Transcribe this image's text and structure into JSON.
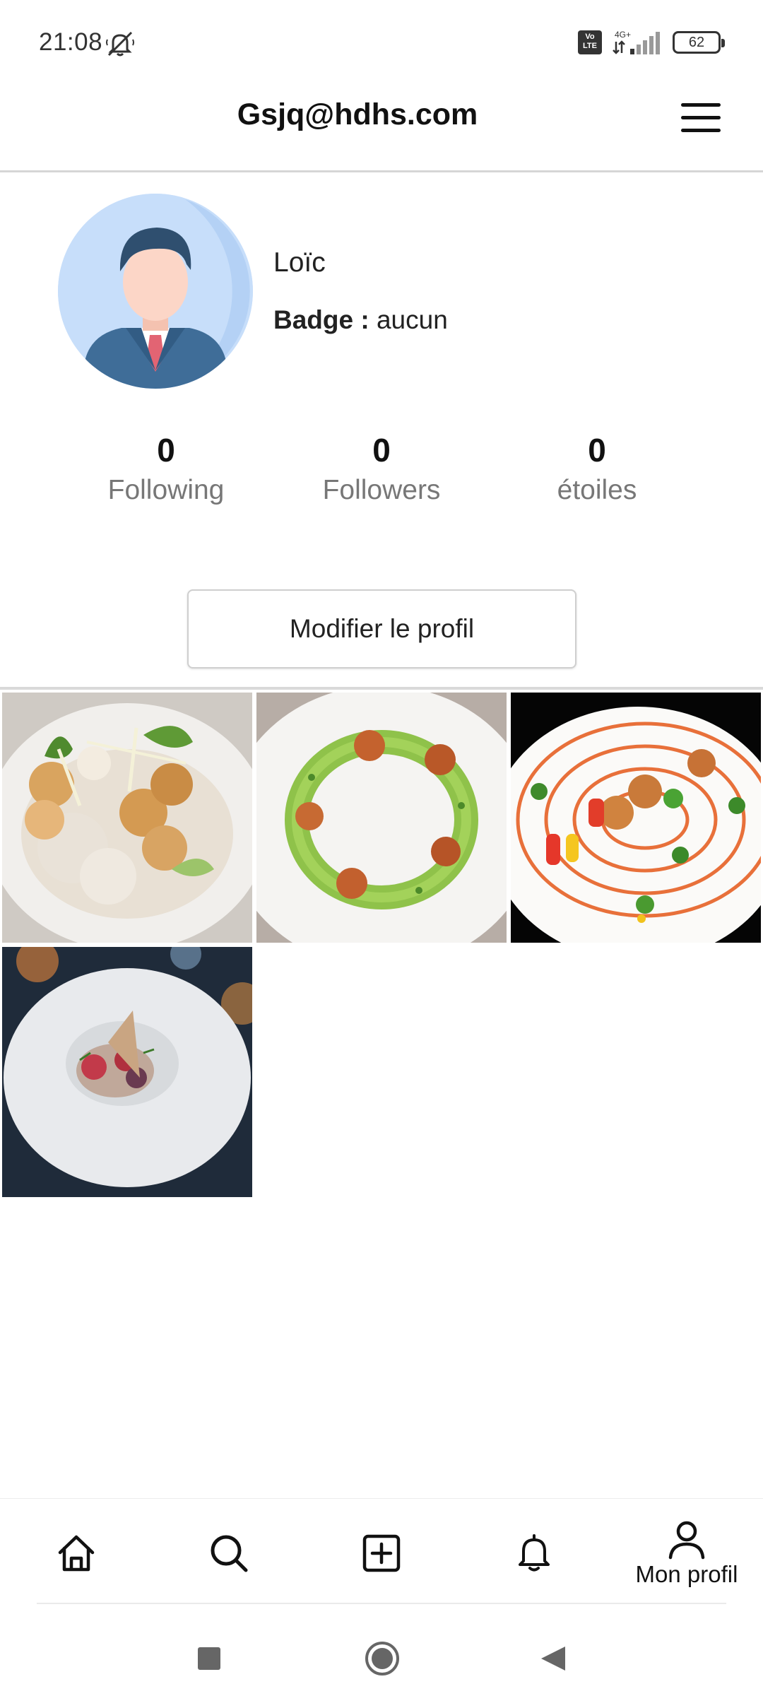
{
  "status_bar": {
    "time": "21:08",
    "volte": "Vo LTE",
    "network": "4G+",
    "battery": "62"
  },
  "header": {
    "title": "Gsjq@hdhs.com"
  },
  "profile": {
    "name": "Loïc",
    "badge_label": "Badge :",
    "badge_value": "aucun"
  },
  "stats": [
    {
      "value": "0",
      "label": "Following"
    },
    {
      "value": "0",
      "label": "Followers"
    },
    {
      "value": "0",
      "label": "étoiles"
    }
  ],
  "edit_button": "Modifier le profil",
  "bottom_nav": {
    "items": [
      {
        "icon": "home-icon"
      },
      {
        "icon": "search-icon"
      },
      {
        "icon": "add-post-icon"
      },
      {
        "icon": "bell-icon"
      },
      {
        "icon": "profile-icon",
        "label": "Mon profil"
      }
    ]
  },
  "colors": {
    "accent": "#111111",
    "muted_text": "#777777",
    "divider": "#d9d9d9",
    "avatar_bg": "#c7defa"
  }
}
